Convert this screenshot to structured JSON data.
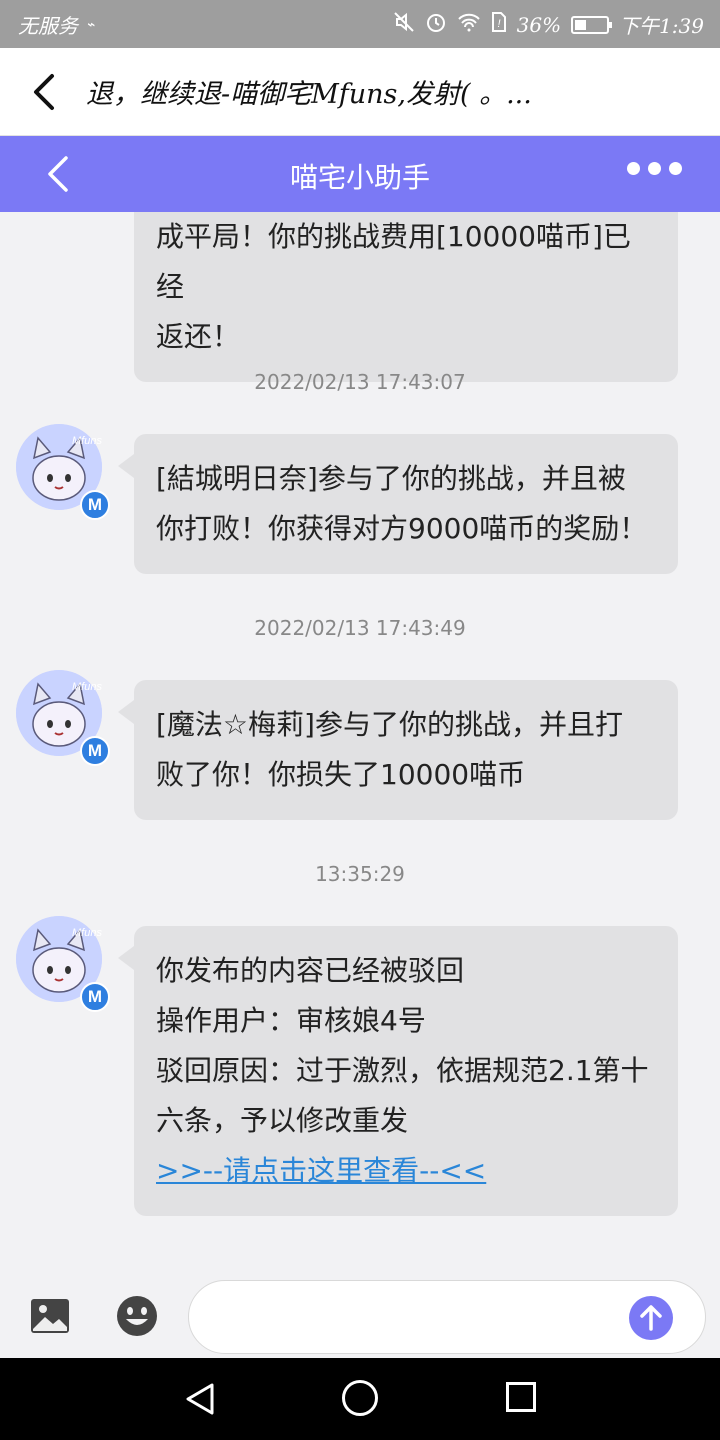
{
  "status_bar": {
    "carrier": "无服务",
    "battery": "36%",
    "battery_level": 0.36,
    "time": "下午1:39"
  },
  "titlebar": {
    "title": "退，继续退-喵御宅Mfuns,发射( 。..."
  },
  "app_header": {
    "title": "喵宅小助手"
  },
  "messages": [
    {
      "lines": [
        "成平局！你的挑战费用[10000喵币]已经",
        "返还！"
      ]
    },
    {
      "timestamp": "2022/02/13 17:43:07",
      "lines": [
        "[結城明日奈]参与了你的挑战，并且被",
        "你打败！你获得对方9000喵币的奖励！"
      ]
    },
    {
      "timestamp": "2022/02/13 17:43:49",
      "lines": [
        "[魔法☆梅莉]参与了你的挑战，并且打",
        "败了你！你损失了10000喵币"
      ]
    },
    {
      "timestamp": "13:35:29",
      "lines": [
        "你发布的内容已经被驳回",
        "操作用户：审核娘4号",
        "驳回原因：过于激烈，依据规范2.1第十",
        "六条，予以修改重发"
      ],
      "link": ">>--请点击这里查看--<<"
    }
  ],
  "avatar": {
    "text": "Mfuns",
    "badge": "M"
  },
  "colors": {
    "accent": "#7b79f5",
    "bubble": "#e1e1e3",
    "link": "#2a86d8",
    "status_bar": "#9e9e9e"
  },
  "icons": {
    "back": "chevron-left-icon",
    "more": "more-dots-icon",
    "image": "image-icon",
    "emoji": "emoji-icon",
    "send": "send-arrow-up-icon"
  }
}
